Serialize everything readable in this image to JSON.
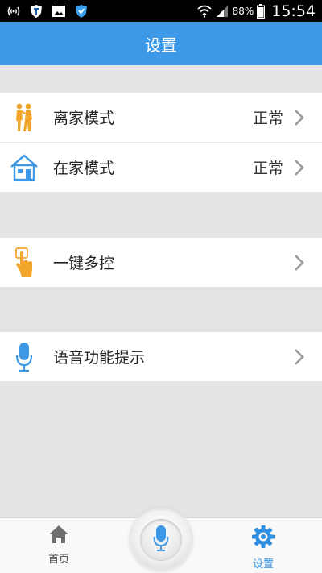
{
  "status_bar": {
    "battery": "88%",
    "time": "15:54",
    "icons": [
      "hotspot-icon",
      "shield-t-icon",
      "gallery-icon",
      "vpn-shield-icon",
      "wifi-icon",
      "signal-icon",
      "battery-icon"
    ]
  },
  "header": {
    "title": "设置"
  },
  "groups": [
    {
      "items": [
        {
          "label": "离家模式",
          "value": "正常",
          "icon": "walking-people-icon"
        },
        {
          "label": "在家模式",
          "value": "正常",
          "icon": "house-icon"
        }
      ]
    },
    {
      "items": [
        {
          "label": "一键多控",
          "value": "",
          "icon": "tap-hand-icon"
        }
      ]
    },
    {
      "items": [
        {
          "label": "语音功能提示",
          "value": "",
          "icon": "microphone-icon"
        }
      ]
    }
  ],
  "bottom_nav": {
    "home_label": "首页",
    "settings_label": "设置",
    "active": "设置"
  },
  "colors": {
    "header": "#3d98e8",
    "accent": "#2f8fe3",
    "icon_orange": "#f2a52b",
    "background": "#e4e4e4"
  }
}
